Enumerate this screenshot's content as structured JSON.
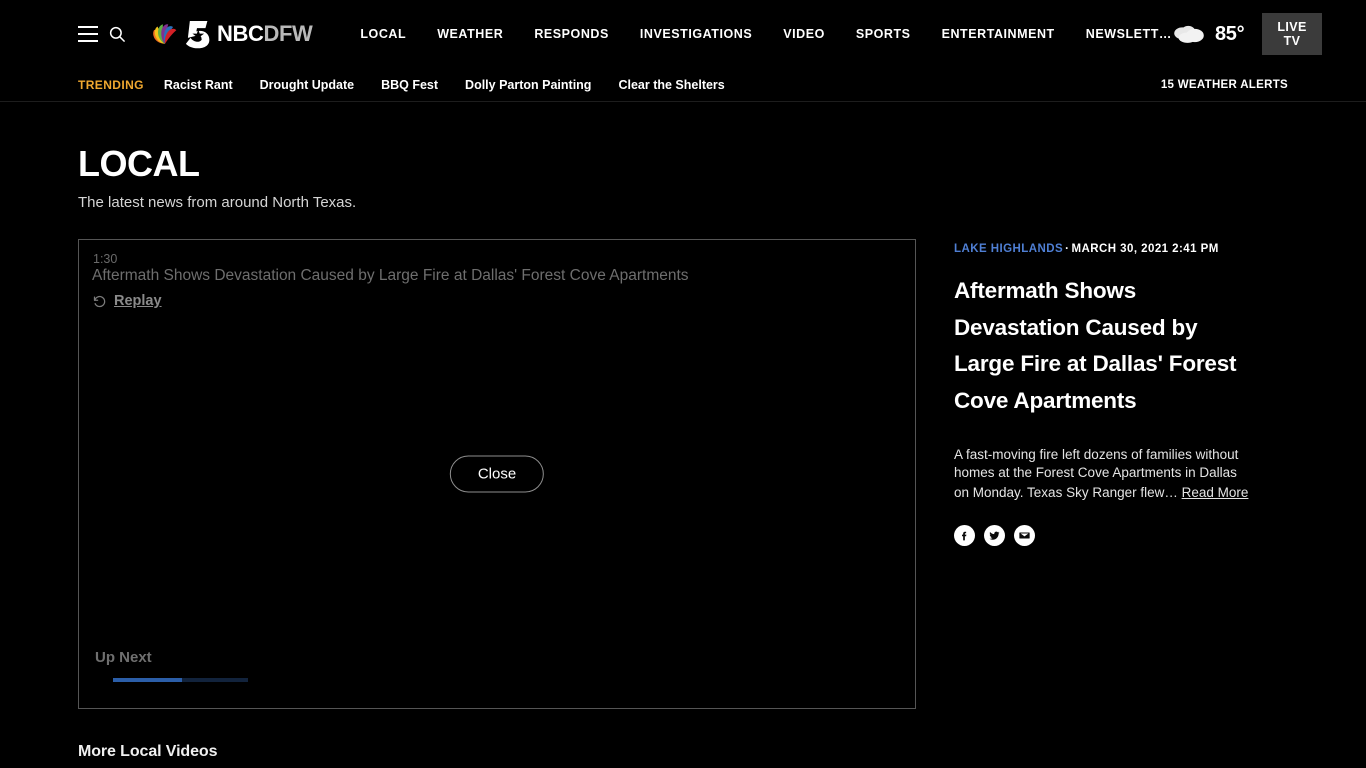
{
  "header": {
    "menu_icon": "hamburger-icon",
    "search_icon": "search-icon",
    "brand_nbc": "NBC",
    "brand_dfw": "DFW",
    "nav_items": [
      {
        "label": "LOCAL"
      },
      {
        "label": "WEATHER"
      },
      {
        "label": "RESPONDS"
      },
      {
        "label": "INVESTIGATIONS"
      },
      {
        "label": "VIDEO"
      },
      {
        "label": "SPORTS"
      },
      {
        "label": "ENTERTAINMENT"
      },
      {
        "label": "NEWSLETT…"
      }
    ],
    "weather": {
      "icon": "cloud-icon",
      "temperature": "85°"
    },
    "live_tv_label": "LIVE TV"
  },
  "trending": {
    "label": "TRENDING",
    "items": [
      {
        "label": "Racist Rant"
      },
      {
        "label": "Drought Update"
      },
      {
        "label": "BBQ Fest"
      },
      {
        "label": "Dolly Parton Painting"
      },
      {
        "label": "Clear the Shelters"
      }
    ],
    "alerts_label": "15 WEATHER ALERTS"
  },
  "page": {
    "title": "LOCAL",
    "subtitle": "The latest news from around North Texas."
  },
  "player": {
    "duration": "1:30",
    "video_title": "Aftermath Shows Devastation Caused by Large Fire at Dallas' Forest Cove Apartments",
    "replay_label": "Replay",
    "replay_icon": "replay-circular-arrow-icon",
    "close_label": "Close",
    "up_next_label": "Up Next",
    "progress_percent": 51
  },
  "article": {
    "location": "LAKE HIGHLANDS",
    "separator": "·",
    "date": "MARCH 30, 2021 2:41 PM",
    "headline": "Aftermath Shows Devastation Caused by Large Fire at Dallas' Forest Cove Apartments",
    "summary": "A fast-moving fire left dozens of families without homes at the Forest Cove Apartments in Dallas on Monday. Texas Sky Ranger flew…",
    "read_more_label": "Read More",
    "share": [
      {
        "name": "facebook-icon"
      },
      {
        "name": "twitter-icon"
      },
      {
        "name": "email-icon"
      }
    ]
  },
  "more_videos": {
    "title": "More Local Videos"
  },
  "colors": {
    "background": "#000000",
    "trending_accent": "#f0a830",
    "location_accent": "#4f7fd4",
    "progress_accent": "#2b5ea8",
    "live_tv_bg": "#3b3b3b"
  }
}
